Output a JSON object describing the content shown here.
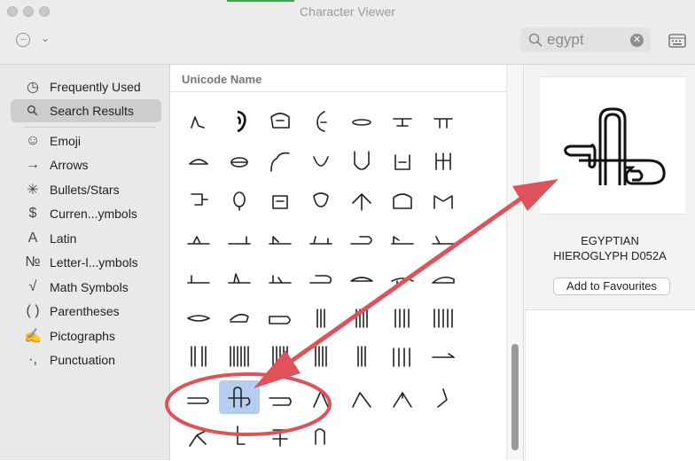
{
  "window": {
    "title": "Character Viewer"
  },
  "toolbar": {
    "search_value": "egypt"
  },
  "sidebar": {
    "items": [
      {
        "label": "Frequently Used",
        "icon": "clock-icon"
      },
      {
        "label": "Search Results",
        "icon": "magnifier-icon",
        "selected": true
      },
      {
        "label": "Emoji",
        "icon": "smiley-icon"
      },
      {
        "label": "Arrows",
        "icon": "arrow-icon"
      },
      {
        "label": "Bullets/Stars",
        "icon": "asterisk-icon"
      },
      {
        "label": "Curren...ymbols",
        "icon": "dollar-icon"
      },
      {
        "label": "Latin",
        "icon": "latin-a-icon"
      },
      {
        "label": "Letter-l...ymbols",
        "icon": "numero-icon"
      },
      {
        "label": "Math Symbols",
        "icon": "sqrt-icon"
      },
      {
        "label": "Parentheses",
        "icon": "parens-icon"
      },
      {
        "label": "Pictographs",
        "icon": "pen-icon"
      },
      {
        "label": "Punctuation",
        "icon": "punctuation-icon"
      }
    ]
  },
  "grid": {
    "column_header": "Unicode Name",
    "selected_glyph": "hieroglyph-d052a"
  },
  "detail": {
    "glyph_name_line1": "EGYPTIAN",
    "glyph_name_line2": "HIEROGLYPH D052A",
    "favourites_button": "Add to Favourites"
  },
  "annotation": {
    "accent": "#e0525a"
  }
}
